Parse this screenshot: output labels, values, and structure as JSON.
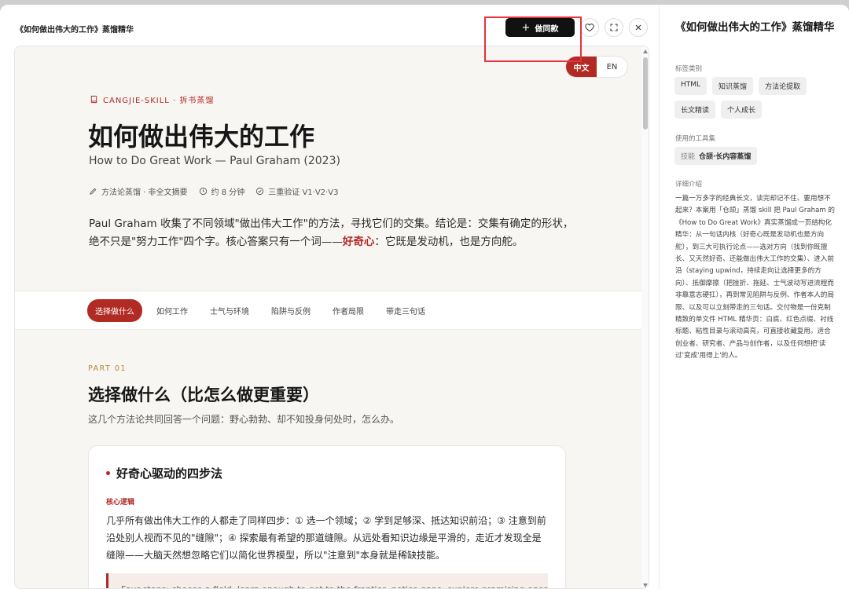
{
  "header": {
    "doc_title": "《如何做出伟大的工作》蒸馏精华",
    "make_same_label": "做同款"
  },
  "preview": {
    "lang_options": [
      "中文",
      "EN"
    ],
    "brand": "CANGJIE-SKILL · 拆书蒸馏",
    "title": "如何做出伟大的工作",
    "subtitle": "How to Do Great Work — Paul Graham (2023)",
    "meta": [
      "方法论蒸馏 · 非全文摘要",
      "约 8 分钟",
      "三重验证 V1·V2·V3"
    ],
    "summary_before": "Paul Graham 收集了不同领域\"做出伟大工作\"的方法，寻找它们的交集。结论是：交集有确定的形状，绝不只是\"努力工作\"四个字。核心答案只有一个词——",
    "summary_keyword": "好奇心",
    "summary_after": "：它既是发动机，也是方向舵。",
    "tabs": [
      "选择做什么",
      "如何工作",
      "士气与环境",
      "陷阱与反例",
      "作者局限",
      "带走三句话"
    ],
    "section": {
      "part": "PART 01",
      "title": "选择做什么（比怎么做更重要）",
      "subtitle": "这几个方法论共同回答一个问题：野心勃勃、却不知投身何处时，怎么办。",
      "card": {
        "title": "好奇心驱动的四步法",
        "label": "核心逻辑",
        "text": "几乎所有做出伟大工作的人都走了同样四步：① 选一个领域；② 学到足够深、抵达知识前沿；③ 注意到前沿处别人视而不见的\"缝隙\"；④ 探索最有希望的那道缝隙。从远处看知识边缘是平滑的，走近才发现全是缝隙——大脑天然想忽略它们以简化世界模型，所以\"注意到\"本身就是稀缺技能。",
        "quote": "Four steps: choose a field, learn enough to get to the frontier, notice gaps, explore promising ones."
      }
    }
  },
  "sidebar": {
    "title": "《如何做出伟大的工作》蒸馏精华",
    "tags_label": "标签类别",
    "tags": [
      "HTML",
      "知识蒸馏",
      "方法论提取",
      "长文精读",
      "个人成长"
    ],
    "tools_label": "使用的工具集",
    "tool_key": "技能",
    "tool_value": "仓颉·长内容蒸馏",
    "desc_label": "详细介绍",
    "description": "一篇一万多字的经典长文，读完却记不住、要用想不起来？本案用「仓颉」蒸馏 skill 把 Paul Graham 的《How to Do Great Work》真实蒸馏成一页结构化精华：从一句话内核（好奇心既是发动机也是方向舵），到三大可执行论点——选对方向（找到你既擅长、又天然好奇、还能做出伟大工作的交集）、进入前沿（staying upwind，持续走向让选择更多的方向）、抵御摩擦（把挫折、拖延、士气波动写进流程而非靠意志硬扛），再到常见陷阱与反例、作者本人的局限、以及可以立刻带走的三句话。交付物是一份克制精致的单文件 HTML 精华页：白底、红色点缀、衬线标题、粘性目录与滚动高亮，可直接收藏复用。适合创业者、研究者、产品与创作者，以及任何想把'读过'变成'用得上'的人。"
  },
  "colors": {
    "accent": "#b22a24",
    "part_label": "#b8862b",
    "highlight_box": "#e8313b"
  }
}
